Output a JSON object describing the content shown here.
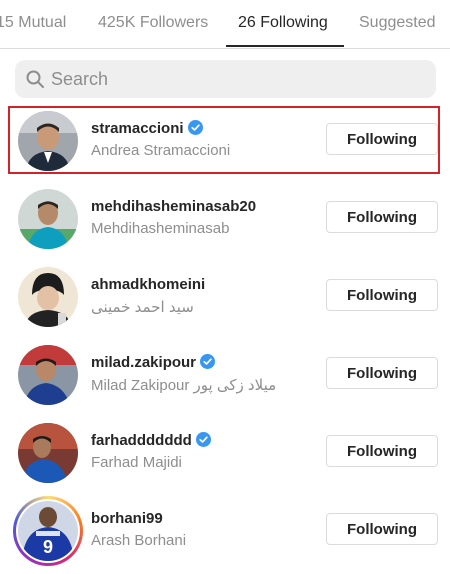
{
  "tabs": [
    {
      "label": "15 Mutual"
    },
    {
      "label": "425K Followers"
    },
    {
      "label": "26 Following"
    },
    {
      "label": "Suggested"
    }
  ],
  "search": {
    "placeholder": "Search",
    "icon": "search-icon"
  },
  "button_label": "Following",
  "colors": {
    "highlight": "#d2232a",
    "verified": "#3897f0",
    "muted": "#8e8e8e"
  },
  "users": [
    {
      "username": "stramaccioni",
      "full_name": "Andrea Stramaccioni",
      "verified": true,
      "highlighted": true
    },
    {
      "username": "mehdihasheminasab20",
      "full_name": "Mehdihasheminasab",
      "verified": false
    },
    {
      "username": "ahmadkhomeini",
      "full_name": "سید احمد خمینی",
      "verified": false
    },
    {
      "username": "milad.zakipour",
      "full_name": "Milad Zakipour میلاد زکی پور",
      "verified": true
    },
    {
      "username": "farhaddddddd",
      "full_name": "Farhad Majidi",
      "verified": true
    },
    {
      "username": "borhani99",
      "full_name": "Arash Borhani",
      "verified": false,
      "story": true
    }
  ]
}
